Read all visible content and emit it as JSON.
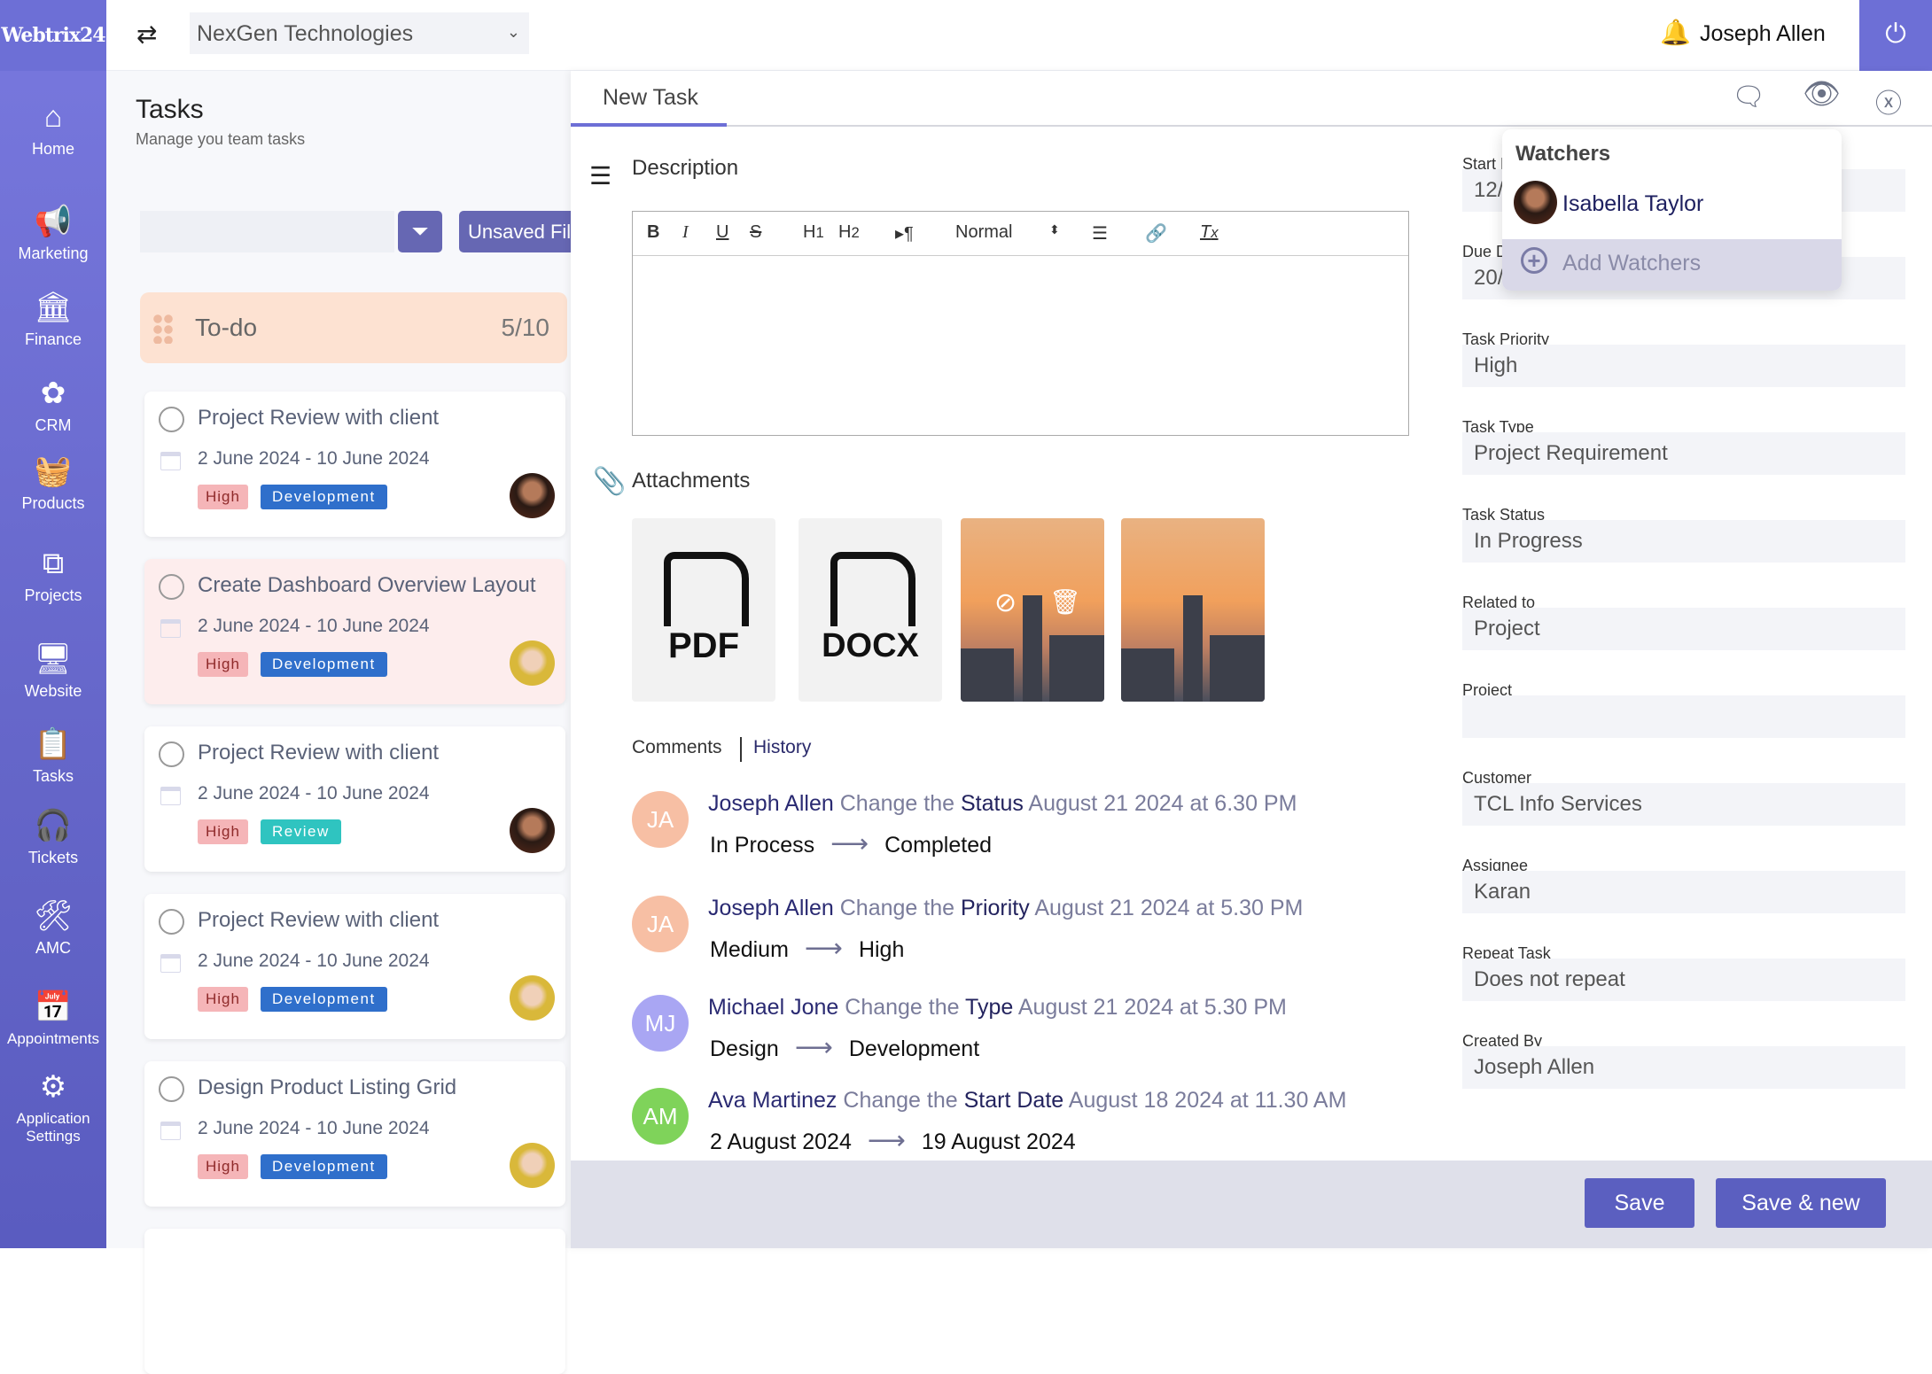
{
  "app": {
    "logo": "Webtrix24",
    "company": "NexGen Technologies",
    "user": "Joseph Allen"
  },
  "sidebar": {
    "items": [
      {
        "label": "Home",
        "icon": "home-icon",
        "glyph": "⌂"
      },
      {
        "label": "Marketing",
        "icon": "megaphone-icon",
        "glyph": "📢"
      },
      {
        "label": "Finance",
        "icon": "bank-icon",
        "glyph": "🏛"
      },
      {
        "label": "CRM",
        "icon": "crm-icon",
        "glyph": "✿"
      },
      {
        "label": "Products",
        "icon": "basket-icon",
        "glyph": "🧺"
      },
      {
        "label": "Projects",
        "icon": "projects-icon",
        "glyph": "⧉"
      },
      {
        "label": "Website",
        "icon": "website-icon",
        "glyph": "🖥"
      },
      {
        "label": "Tasks",
        "icon": "clipboard-icon",
        "glyph": "📋"
      },
      {
        "label": "Tickets",
        "icon": "headset-icon",
        "glyph": "🎧"
      },
      {
        "label": "AMC",
        "icon": "tools-icon",
        "glyph": "🛠"
      },
      {
        "label": "Appointments",
        "icon": "calendar-icon",
        "glyph": "📅"
      },
      {
        "label": "Application Settings",
        "icon": "gears-icon",
        "glyph": "⚙"
      }
    ]
  },
  "tasks": {
    "title": "Tasks",
    "subtitle": "Manage you team tasks",
    "search_placeholder": "",
    "unsaved_filter": "Unsaved Filter",
    "column": {
      "label": "To-do",
      "count": "5/10"
    },
    "cards": [
      {
        "title": "Project Review with client",
        "dates": "2 June 2024 - 10 June 2024",
        "priority": "High",
        "tag": "Development",
        "tag_color": "#2f6fcb",
        "highlight": false
      },
      {
        "title": "Create Dashboard Overview Layout",
        "dates": "2 June 2024 - 10 June 2024",
        "priority": "High",
        "tag": "Development",
        "tag_color": "#2f6fcb",
        "highlight": true
      },
      {
        "title": "Project Review with client",
        "dates": "2 June 2024 - 10 June 2024",
        "priority": "High",
        "tag": "Review",
        "tag_color": "#2fc4c0",
        "highlight": false
      },
      {
        "title": "Project Review with client",
        "dates": "2 June 2024 - 10 June 2024",
        "priority": "High",
        "tag": "Development",
        "tag_color": "#2f6fcb",
        "highlight": false
      },
      {
        "title": "Design Product Listing Grid",
        "dates": "2 June 2024 - 10 June 2024",
        "priority": "High",
        "tag": "Development",
        "tag_color": "#2f6fcb",
        "highlight": false
      }
    ]
  },
  "task_form": {
    "tab": "New Task",
    "description_label": "Description",
    "editor": {
      "format": "Normal"
    },
    "attachments_label": "Attachments",
    "attachments": [
      {
        "type": "PDF"
      },
      {
        "type": "DOCX"
      },
      {
        "type": "image"
      },
      {
        "type": "image"
      }
    ],
    "comments_tab": "Comments",
    "history_tab": "History",
    "history": [
      {
        "initials": "JA",
        "color": "#f7bfa4",
        "user": "Joseph Allen",
        "verb": "Change the",
        "field": "Status",
        "when": "August 21 2024 at 6.30 PM",
        "from": "In Process",
        "to": "Completed"
      },
      {
        "initials": "JA",
        "color": "#f7bfa4",
        "user": "Joseph Allen",
        "verb": "Change the",
        "field": "Priority",
        "when": "August 21 2024 at 5.30 PM",
        "from": "Medium",
        "to": "High"
      },
      {
        "initials": "MJ",
        "color": "#a9a6f3",
        "user": "Michael Jone",
        "verb": "Change the",
        "field": "Type",
        "when": "August 21 2024 at 5.30 PM",
        "from": "Design",
        "to": "Development"
      },
      {
        "initials": "AM",
        "color": "#7fd35a",
        "user": "Ava Martinez",
        "verb": "Change the",
        "field": "Start Date",
        "when": "August 18 2024 at 11.30 AM",
        "from": "2 August 2024",
        "to": "19 August 2024"
      }
    ],
    "fields": [
      {
        "label": "Start Date",
        "value": "12/"
      },
      {
        "label": "Due Date",
        "value": "20/"
      },
      {
        "label": "Task Priority",
        "value": "High"
      },
      {
        "label": "Task Type",
        "value": "Project Requirement"
      },
      {
        "label": "Task Status",
        "value": "In Progress"
      },
      {
        "label": "Related to",
        "value": "Project"
      },
      {
        "label": "Project",
        "value": ""
      },
      {
        "label": "Customer",
        "value": "TCL Info Services"
      },
      {
        "label": "Assignee",
        "value": "Karan"
      },
      {
        "label": "Repeat Task",
        "value": "Does not repeat"
      },
      {
        "label": "Created By",
        "value": "Joseph Allen"
      }
    ],
    "save": "Save",
    "save_new": "Save & new"
  },
  "watchers": {
    "title": "Watchers",
    "items": [
      {
        "name": "Isabella Taylor"
      }
    ],
    "add_label": "Add Watchers"
  }
}
